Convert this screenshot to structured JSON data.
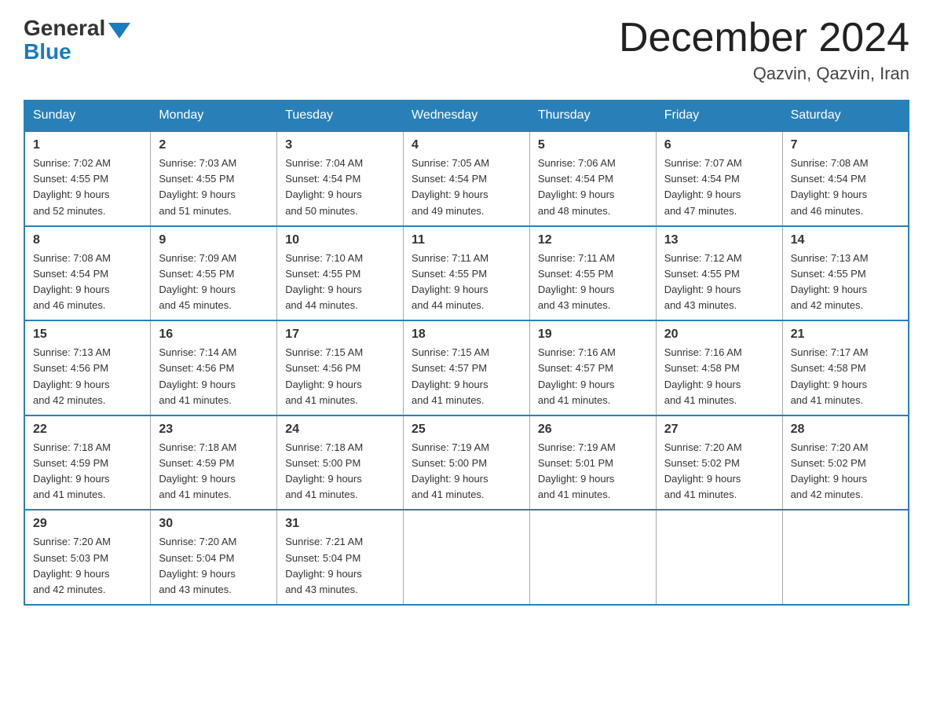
{
  "header": {
    "logo_general": "General",
    "logo_blue": "Blue",
    "main_title": "December 2024",
    "subtitle": "Qazvin, Qazvin, Iran"
  },
  "weekdays": [
    "Sunday",
    "Monday",
    "Tuesday",
    "Wednesday",
    "Thursday",
    "Friday",
    "Saturday"
  ],
  "weeks": [
    [
      {
        "day": "1",
        "sunrise": "7:02 AM",
        "sunset": "4:55 PM",
        "daylight": "9 hours and 52 minutes."
      },
      {
        "day": "2",
        "sunrise": "7:03 AM",
        "sunset": "4:55 PM",
        "daylight": "9 hours and 51 minutes."
      },
      {
        "day": "3",
        "sunrise": "7:04 AM",
        "sunset": "4:54 PM",
        "daylight": "9 hours and 50 minutes."
      },
      {
        "day": "4",
        "sunrise": "7:05 AM",
        "sunset": "4:54 PM",
        "daylight": "9 hours and 49 minutes."
      },
      {
        "day": "5",
        "sunrise": "7:06 AM",
        "sunset": "4:54 PM",
        "daylight": "9 hours and 48 minutes."
      },
      {
        "day": "6",
        "sunrise": "7:07 AM",
        "sunset": "4:54 PM",
        "daylight": "9 hours and 47 minutes."
      },
      {
        "day": "7",
        "sunrise": "7:08 AM",
        "sunset": "4:54 PM",
        "daylight": "9 hours and 46 minutes."
      }
    ],
    [
      {
        "day": "8",
        "sunrise": "7:08 AM",
        "sunset": "4:54 PM",
        "daylight": "9 hours and 46 minutes."
      },
      {
        "day": "9",
        "sunrise": "7:09 AM",
        "sunset": "4:55 PM",
        "daylight": "9 hours and 45 minutes."
      },
      {
        "day": "10",
        "sunrise": "7:10 AM",
        "sunset": "4:55 PM",
        "daylight": "9 hours and 44 minutes."
      },
      {
        "day": "11",
        "sunrise": "7:11 AM",
        "sunset": "4:55 PM",
        "daylight": "9 hours and 44 minutes."
      },
      {
        "day": "12",
        "sunrise": "7:11 AM",
        "sunset": "4:55 PM",
        "daylight": "9 hours and 43 minutes."
      },
      {
        "day": "13",
        "sunrise": "7:12 AM",
        "sunset": "4:55 PM",
        "daylight": "9 hours and 43 minutes."
      },
      {
        "day": "14",
        "sunrise": "7:13 AM",
        "sunset": "4:55 PM",
        "daylight": "9 hours and 42 minutes."
      }
    ],
    [
      {
        "day": "15",
        "sunrise": "7:13 AM",
        "sunset": "4:56 PM",
        "daylight": "9 hours and 42 minutes."
      },
      {
        "day": "16",
        "sunrise": "7:14 AM",
        "sunset": "4:56 PM",
        "daylight": "9 hours and 41 minutes."
      },
      {
        "day": "17",
        "sunrise": "7:15 AM",
        "sunset": "4:56 PM",
        "daylight": "9 hours and 41 minutes."
      },
      {
        "day": "18",
        "sunrise": "7:15 AM",
        "sunset": "4:57 PM",
        "daylight": "9 hours and 41 minutes."
      },
      {
        "day": "19",
        "sunrise": "7:16 AM",
        "sunset": "4:57 PM",
        "daylight": "9 hours and 41 minutes."
      },
      {
        "day": "20",
        "sunrise": "7:16 AM",
        "sunset": "4:58 PM",
        "daylight": "9 hours and 41 minutes."
      },
      {
        "day": "21",
        "sunrise": "7:17 AM",
        "sunset": "4:58 PM",
        "daylight": "9 hours and 41 minutes."
      }
    ],
    [
      {
        "day": "22",
        "sunrise": "7:18 AM",
        "sunset": "4:59 PM",
        "daylight": "9 hours and 41 minutes."
      },
      {
        "day": "23",
        "sunrise": "7:18 AM",
        "sunset": "4:59 PM",
        "daylight": "9 hours and 41 minutes."
      },
      {
        "day": "24",
        "sunrise": "7:18 AM",
        "sunset": "5:00 PM",
        "daylight": "9 hours and 41 minutes."
      },
      {
        "day": "25",
        "sunrise": "7:19 AM",
        "sunset": "5:00 PM",
        "daylight": "9 hours and 41 minutes."
      },
      {
        "day": "26",
        "sunrise": "7:19 AM",
        "sunset": "5:01 PM",
        "daylight": "9 hours and 41 minutes."
      },
      {
        "day": "27",
        "sunrise": "7:20 AM",
        "sunset": "5:02 PM",
        "daylight": "9 hours and 41 minutes."
      },
      {
        "day": "28",
        "sunrise": "7:20 AM",
        "sunset": "5:02 PM",
        "daylight": "9 hours and 42 minutes."
      }
    ],
    [
      {
        "day": "29",
        "sunrise": "7:20 AM",
        "sunset": "5:03 PM",
        "daylight": "9 hours and 42 minutes."
      },
      {
        "day": "30",
        "sunrise": "7:20 AM",
        "sunset": "5:04 PM",
        "daylight": "9 hours and 43 minutes."
      },
      {
        "day": "31",
        "sunrise": "7:21 AM",
        "sunset": "5:04 PM",
        "daylight": "9 hours and 43 minutes."
      },
      null,
      null,
      null,
      null
    ]
  ],
  "labels": {
    "sunrise": "Sunrise:",
    "sunset": "Sunset:",
    "daylight": "Daylight:"
  }
}
